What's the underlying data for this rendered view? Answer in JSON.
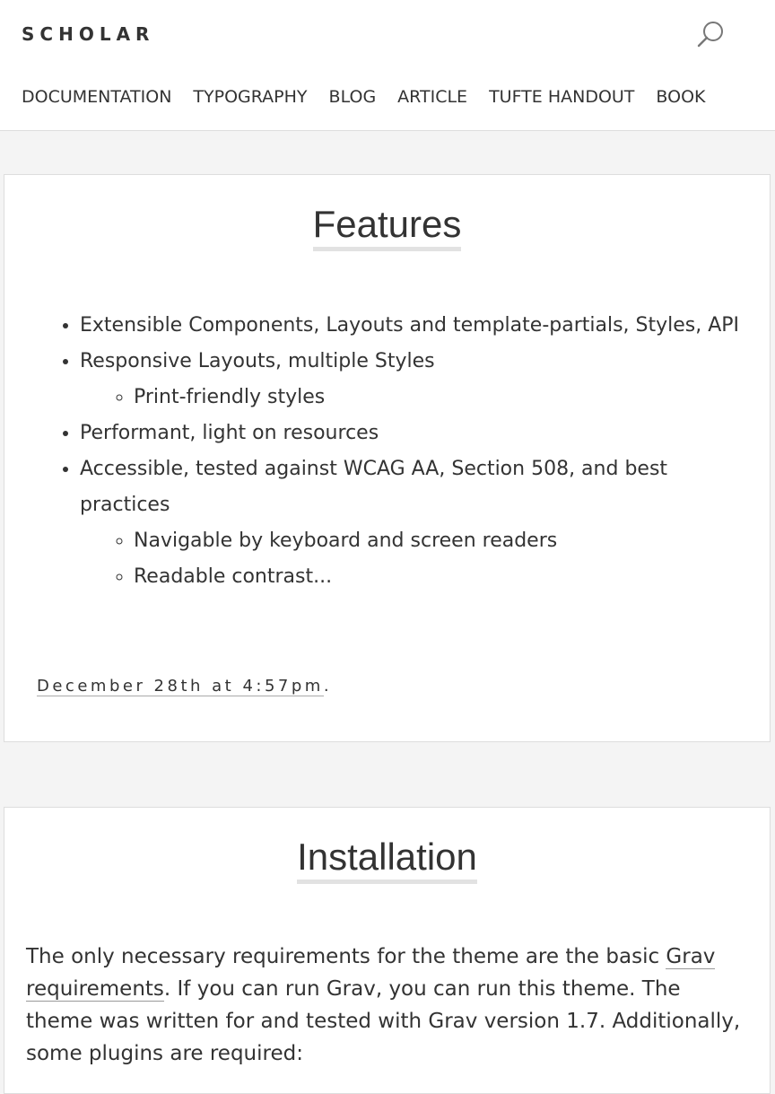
{
  "header": {
    "brand": "SCHOLAR",
    "search_icon": "search-icon",
    "nav": [
      "DOCUMENTATION",
      "TYPOGRAPHY",
      "BLOG",
      "ARTICLE",
      "TUFTE HANDOUT",
      "BOOK"
    ]
  },
  "features": {
    "title": "Features",
    "items": [
      "Extensible Components, Layouts and template-partials, Styles, API",
      "Responsive Layouts, multiple Styles",
      "Print-friendly styles",
      "Performant, light on resources",
      "Accessible, tested against WCAG AA, Section 508, and best practices",
      "Navigable by keyboard and screen readers",
      "Readable contrast..."
    ],
    "timestamp": "December 28th at 4:57pm",
    "timestamp_suffix": "."
  },
  "installation": {
    "title": "Installation",
    "text_before": "The only necessary requirements for the theme are the basic ",
    "link": "Grav requirements",
    "text_after": ". If you can run Grav, you can run this theme. The theme was written for and tested with Grav version 1.7. Additionally, some plugins are required:"
  }
}
